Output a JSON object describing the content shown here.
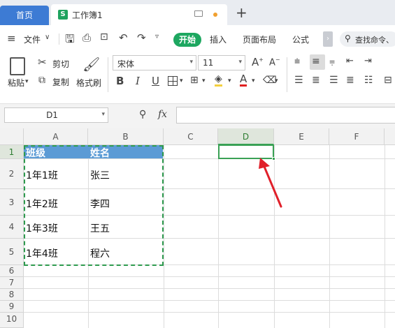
{
  "tabs": {
    "home": "首页",
    "doc_icon": "S",
    "doc_title": "工作簿1"
  },
  "menu": {
    "file": "文件",
    "start": "开始",
    "insert": "插入",
    "page_layout": "页面布局",
    "formula": "公式",
    "search": "查找命令、"
  },
  "ribbon": {
    "paste": "粘贴",
    "cut": "剪切",
    "copy": "复制",
    "format_painter": "格式刷",
    "font_name": "宋体",
    "font_size": "11"
  },
  "formula_bar": {
    "name_box": "D1",
    "fx": "fx",
    "value": ""
  },
  "grid": {
    "columns": [
      "A",
      "B",
      "C",
      "D",
      "E",
      "F"
    ],
    "rows": [
      "1",
      "2",
      "3",
      "4",
      "5",
      "6",
      "7",
      "8",
      "9",
      "10"
    ],
    "header": [
      "班级",
      "姓名"
    ],
    "data": [
      [
        "1年1班",
        "张三"
      ],
      [
        "1年2班",
        "李四"
      ],
      [
        "1年3班",
        "王五"
      ],
      [
        "1年4班",
        "程六"
      ]
    ],
    "selected_cell": "D1"
  },
  "colors": {
    "accent": "#1da760",
    "home_tab": "#3d7bd4",
    "header_fill": "#5b9bd5",
    "arrow": "#e0202a"
  }
}
